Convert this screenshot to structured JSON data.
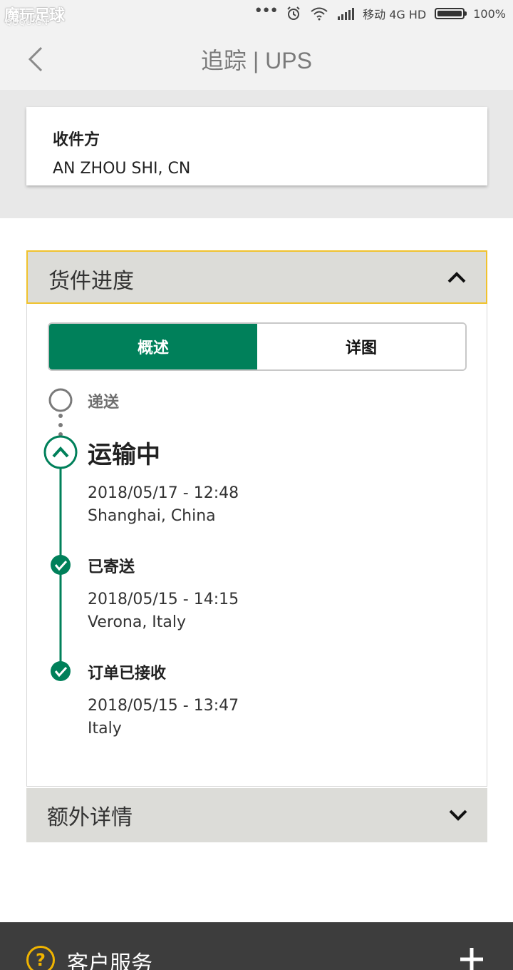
{
  "status_bar": {
    "watermark": "魔玩足球",
    "watermark_sub": "QUQU.CN",
    "dots": "•••",
    "carrier": "移动 4G HD",
    "battery": "100%",
    "battery_level": 1.0,
    "icons": [
      "alarm-icon",
      "wifi-icon",
      "signal-icon",
      "battery-icon"
    ]
  },
  "header": {
    "title": "追踪 | UPS",
    "back_icon": "chevron-left-icon"
  },
  "recipient": {
    "label": "收件方",
    "value": "AN ZHOU SHI, CN"
  },
  "progress": {
    "title": "货件进度",
    "tabs": [
      {
        "label": "概述",
        "active": true
      },
      {
        "label": "详图",
        "active": false
      }
    ],
    "steps": [
      {
        "status": "pending",
        "label": "递送"
      },
      {
        "status": "current",
        "label": "运输中",
        "date": "2018/05/17 - 12:48",
        "location": "Shanghai, China"
      },
      {
        "status": "done",
        "label": "已寄送",
        "date": "2018/05/15 - 14:15",
        "location": "Verona, Italy"
      },
      {
        "status": "done",
        "label": "订单已接收",
        "date": "2018/05/15 - 13:47",
        "location": "Italy"
      }
    ]
  },
  "extra_details": {
    "title": "额外详情"
  },
  "footer": {
    "title": "客户服务",
    "help_glyph": "?"
  },
  "colors": {
    "accent_green": "#00805a",
    "highlight_border": "#f0c22e",
    "footer_bg": "#3d3d3d",
    "help_yellow": "#f0b400"
  }
}
